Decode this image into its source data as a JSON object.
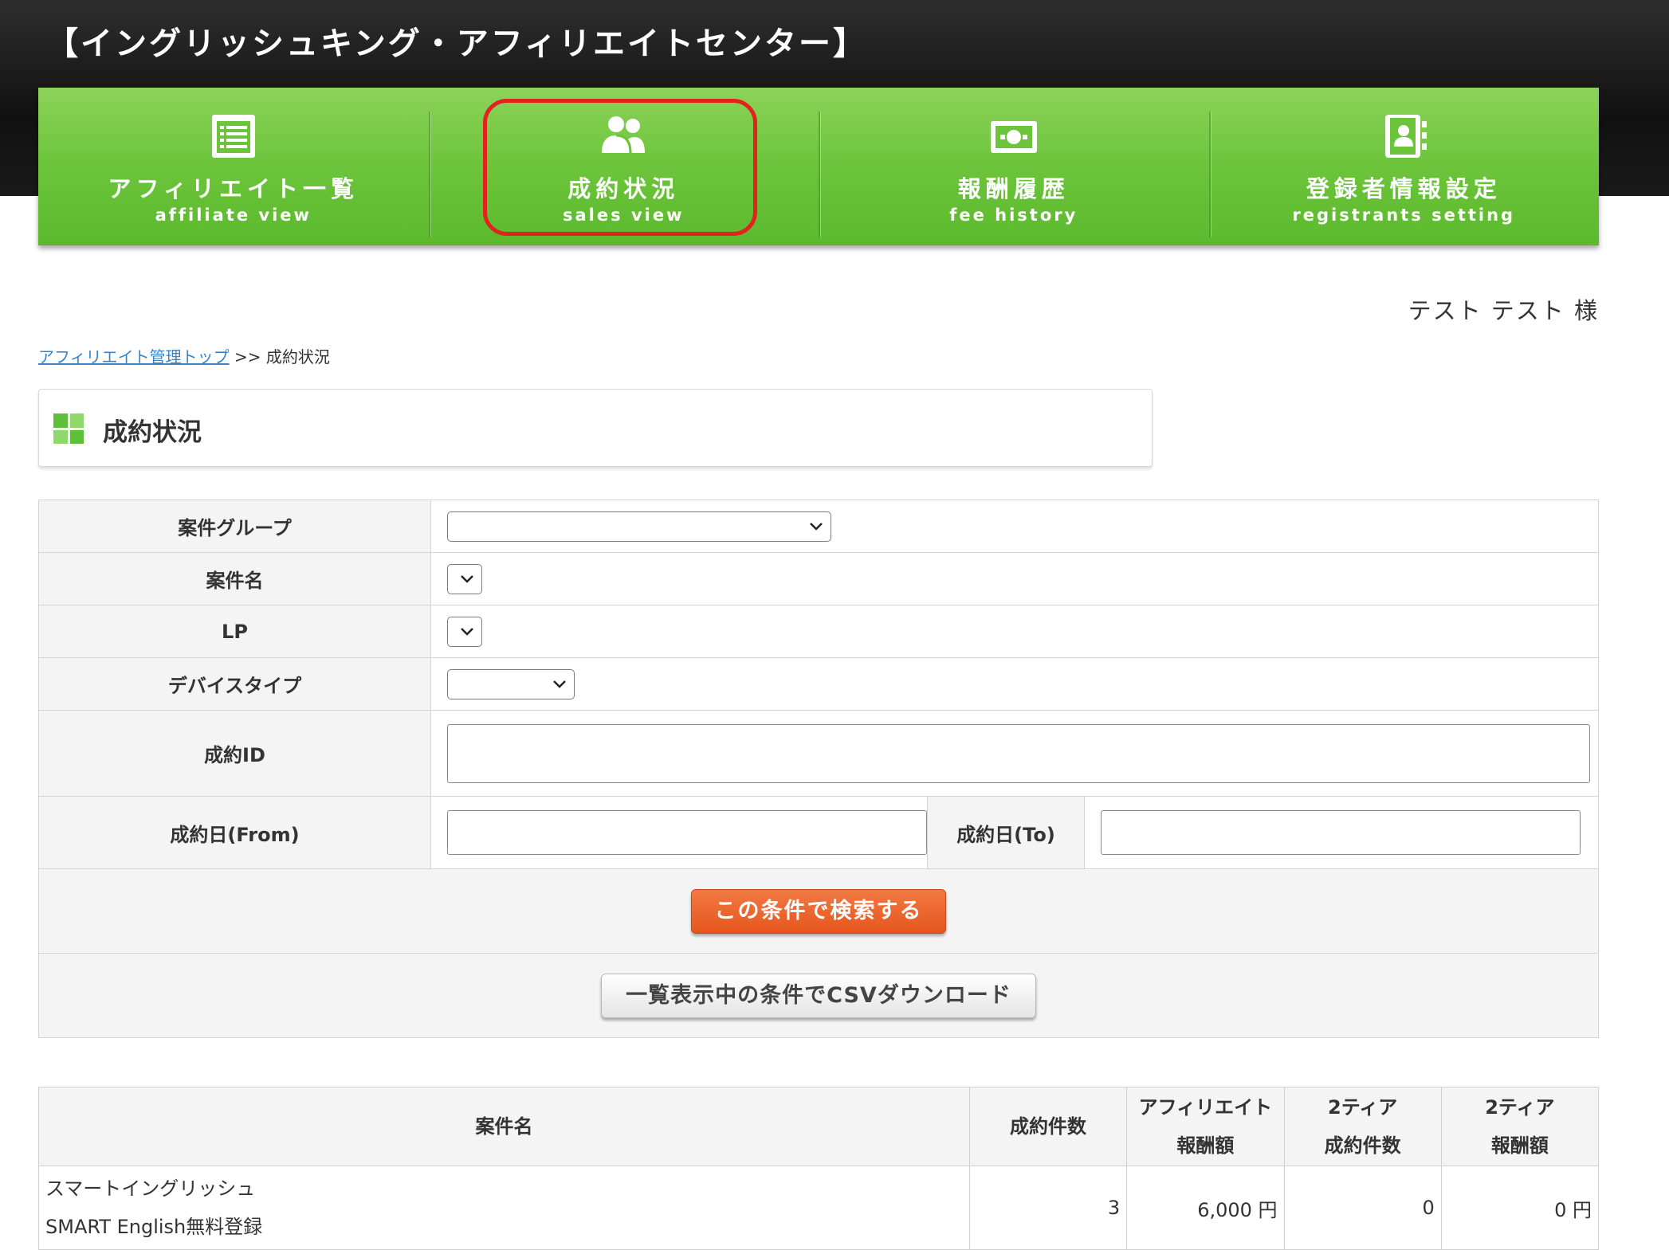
{
  "site_title": "【イングリッシュキング・アフィリエイトセンター】",
  "nav": [
    {
      "jp": "アフィリエイト一覧",
      "en": "affiliate view",
      "icon": "list-icon"
    },
    {
      "jp": "成約状況",
      "en": "sales view",
      "icon": "users-icon"
    },
    {
      "jp": "報酬履歴",
      "en": "fee history",
      "icon": "money-icon"
    },
    {
      "jp": "登録者情報設定",
      "en": "registrants setting",
      "icon": "contact-book-icon"
    }
  ],
  "user_name": "テスト テスト 様",
  "breadcrumb": {
    "link": "アフィリエイト管理トップ",
    "separator": ">>",
    "current": "成約状況"
  },
  "page_heading": "成約状況",
  "search_form": {
    "campaign_group_label": "案件グループ",
    "campaign_name_label": "案件名",
    "lp_label": "LP",
    "device_type_label": "デバイスタイプ",
    "sale_id_label": "成約ID",
    "date_from_label": "成約日(From)",
    "date_to_label": "成約日(To)",
    "search_button": "この条件で検索する",
    "csv_button": "一覧表示中の条件でCSVダウンロード"
  },
  "results": {
    "headers": {
      "campaign": "案件名",
      "sales_count": "成約件数",
      "affiliate_fee_line1": "アフィリエイト",
      "affiliate_fee_line2": "報酬額",
      "tier2_count_line1": "2ティア",
      "tier2_count_line2": "成約件数",
      "tier2_fee_line1": "2ティア",
      "tier2_fee_line2": "報酬額"
    },
    "rows": [
      {
        "campaign_line1": "スマートイングリッシュ",
        "campaign_line2": "SMART English無料登録",
        "sales_count": "3",
        "affiliate_fee": "6,000 円",
        "tier2_count": "0",
        "tier2_fee": "0 円"
      }
    ]
  },
  "colors": {
    "nav_green": "#6cc43a",
    "highlight_red": "#e2221e",
    "search_orange": "#e5561c",
    "link_blue": "#3a84c7"
  }
}
